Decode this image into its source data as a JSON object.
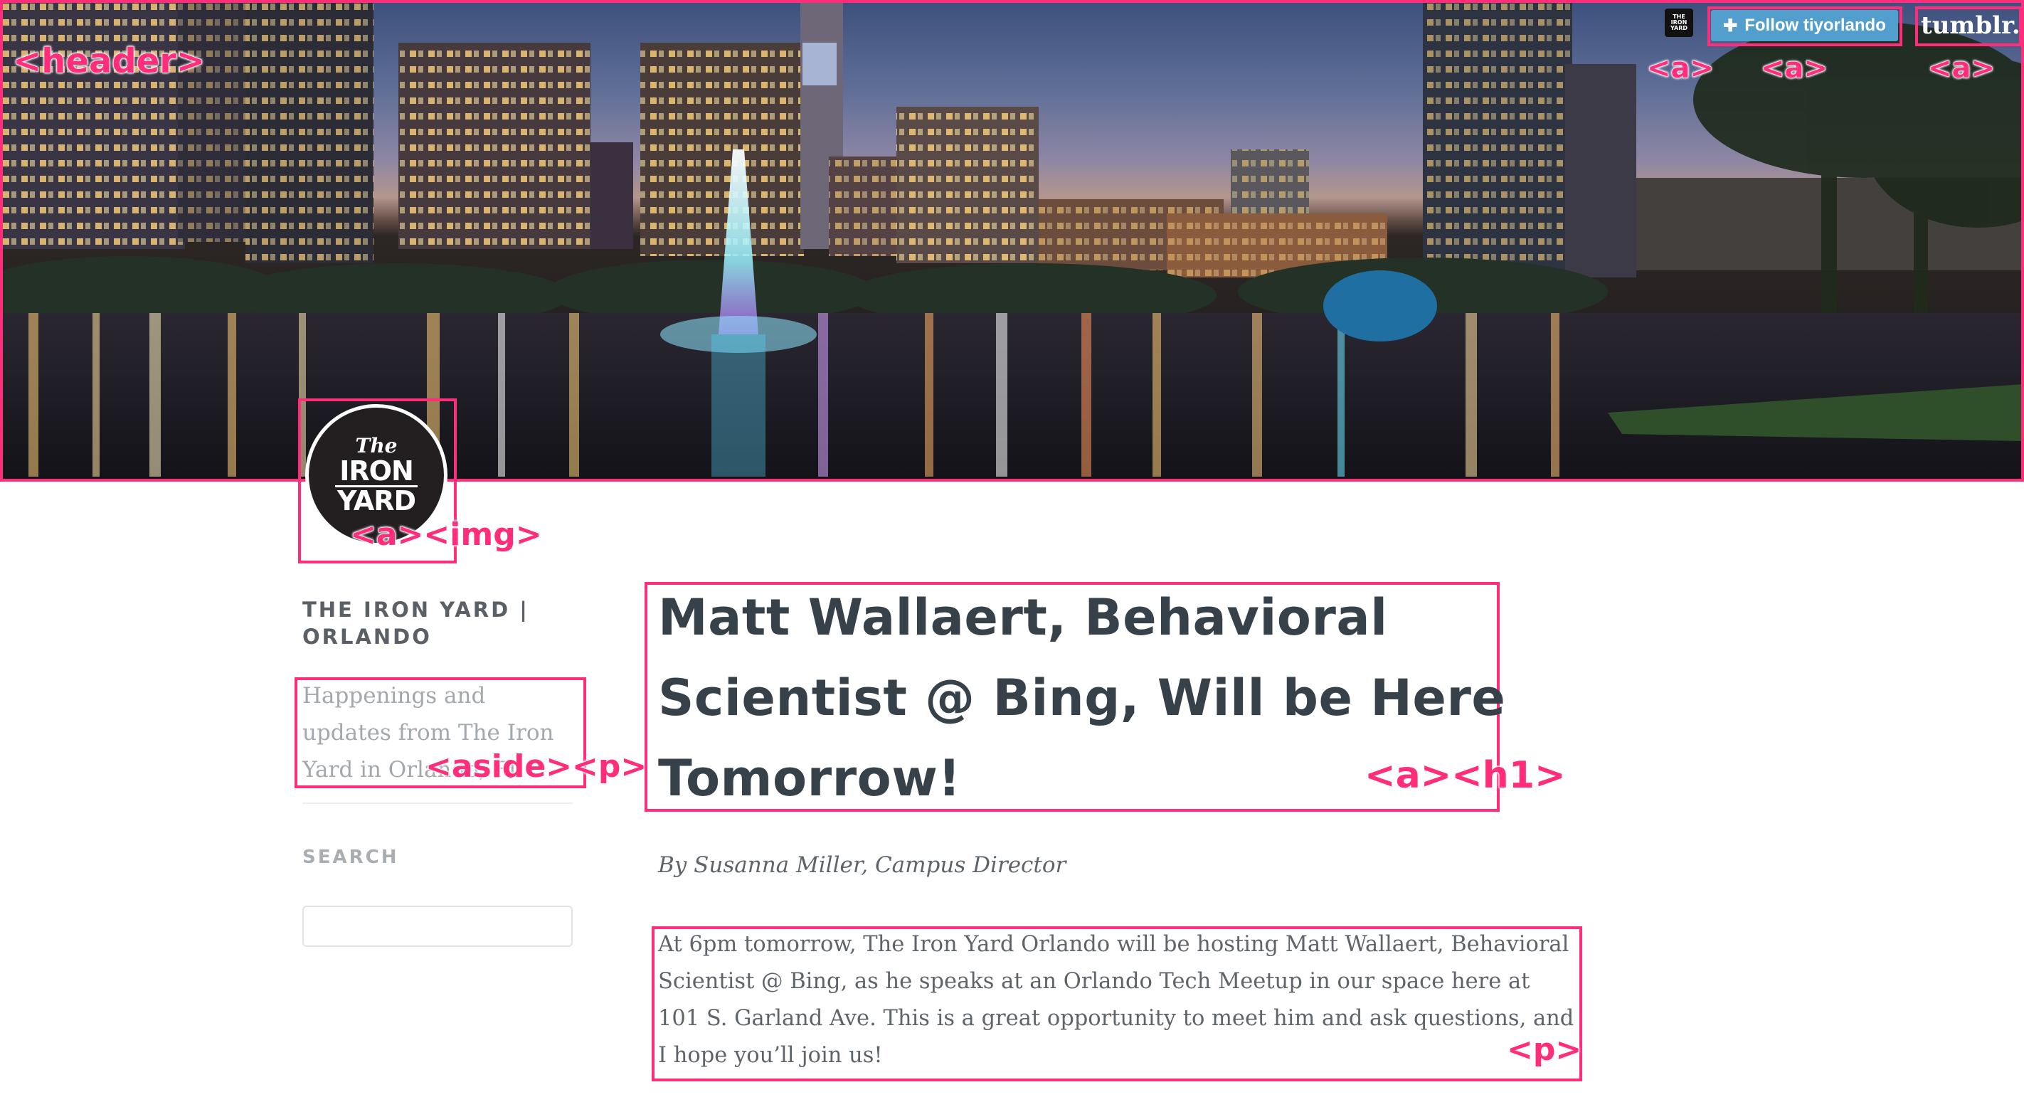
{
  "header": {
    "follow_button": {
      "icon": "plus-icon",
      "label": "Follow tiyorlando"
    },
    "tumblr_logo": "tumblr.",
    "blog_avatar_text": "THE IRON YARD"
  },
  "logo": {
    "the": "The",
    "iron": "IRON",
    "yard": "YARD"
  },
  "sidebar": {
    "site_title": "THE IRON YARD | ORLANDO",
    "tagline": "Happenings and updates from The Iron Yard in Orlando, FL",
    "search_label": "SEARCH",
    "search_value": ""
  },
  "post": {
    "title": "Matt Wallaert, Behavioral Scientist @ Bing, Will be Here Tomorrow!",
    "byline": "By Susanna Miller, Campus Director",
    "body": "At 6pm tomorrow, The Iron Yard Orlando will be hosting Matt Wallaert, Behavioral Scientist @ Bing, as he speaks at an Orlando Tech Meetup in our space here at 101 S. Garland Ave. This is a great opportunity to meet him and ask questions, and I hope you’ll join us!"
  },
  "annotations": {
    "header": "<header>",
    "avatar_link": "<a>",
    "follow_link": "<a>",
    "tumblr_link": "<a>",
    "logo": "<a><img>",
    "tagline": "<aside><p>",
    "title": "<a><h1>",
    "body": "<p>"
  },
  "colors": {
    "annotation": "#ff2d7a",
    "follow_button": "#529ecc",
    "title_text": "#37414a",
    "body_text": "#5e6469",
    "muted_text": "#a3a8ad"
  }
}
